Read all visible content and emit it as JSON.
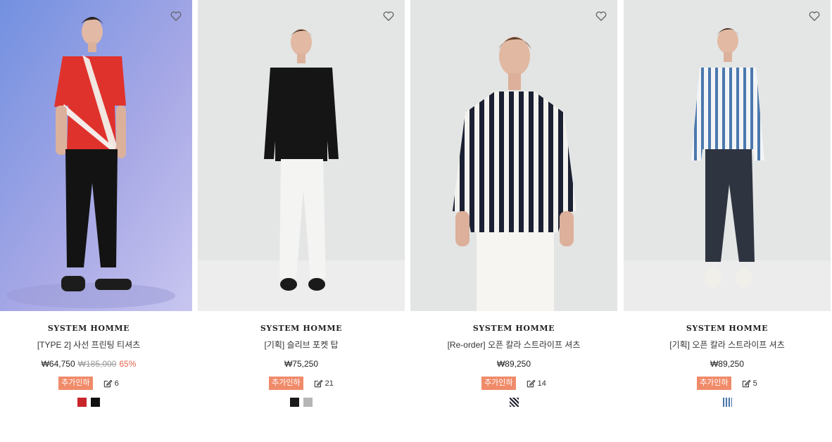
{
  "products": [
    {
      "brand": "SYSTEM HOMME",
      "name": "[TYPE 2] 사선 프린팅 티셔츠",
      "price": "₩64,750",
      "original_price": "₩185,000",
      "discount": "65%",
      "coupon_label": "추가인하",
      "review_count": "6",
      "swatches": [
        "#c8262b",
        "#111111"
      ]
    },
    {
      "brand": "SYSTEM HOMME",
      "name": "[기획] 슬리브 포켓 탑",
      "price": "₩75,250",
      "coupon_label": "추가인하",
      "review_count": "21",
      "swatches": [
        "#1a1a1a",
        "#b5b5b5"
      ]
    },
    {
      "brand": "SYSTEM HOMME",
      "name": "[Re-order] 오픈 칼라 스트라이프 셔츠",
      "price": "₩89,250",
      "coupon_label": "추가인하",
      "review_count": "14",
      "swatches": [
        "stripe-navy"
      ]
    },
    {
      "brand": "SYSTEM HOMME",
      "name": "[기획] 오픈 칼라 스트라이프 셔츠",
      "price": "₩89,250",
      "coupon_label": "추가인하",
      "review_count": "5",
      "swatches": [
        "stripe-blue"
      ]
    }
  ]
}
